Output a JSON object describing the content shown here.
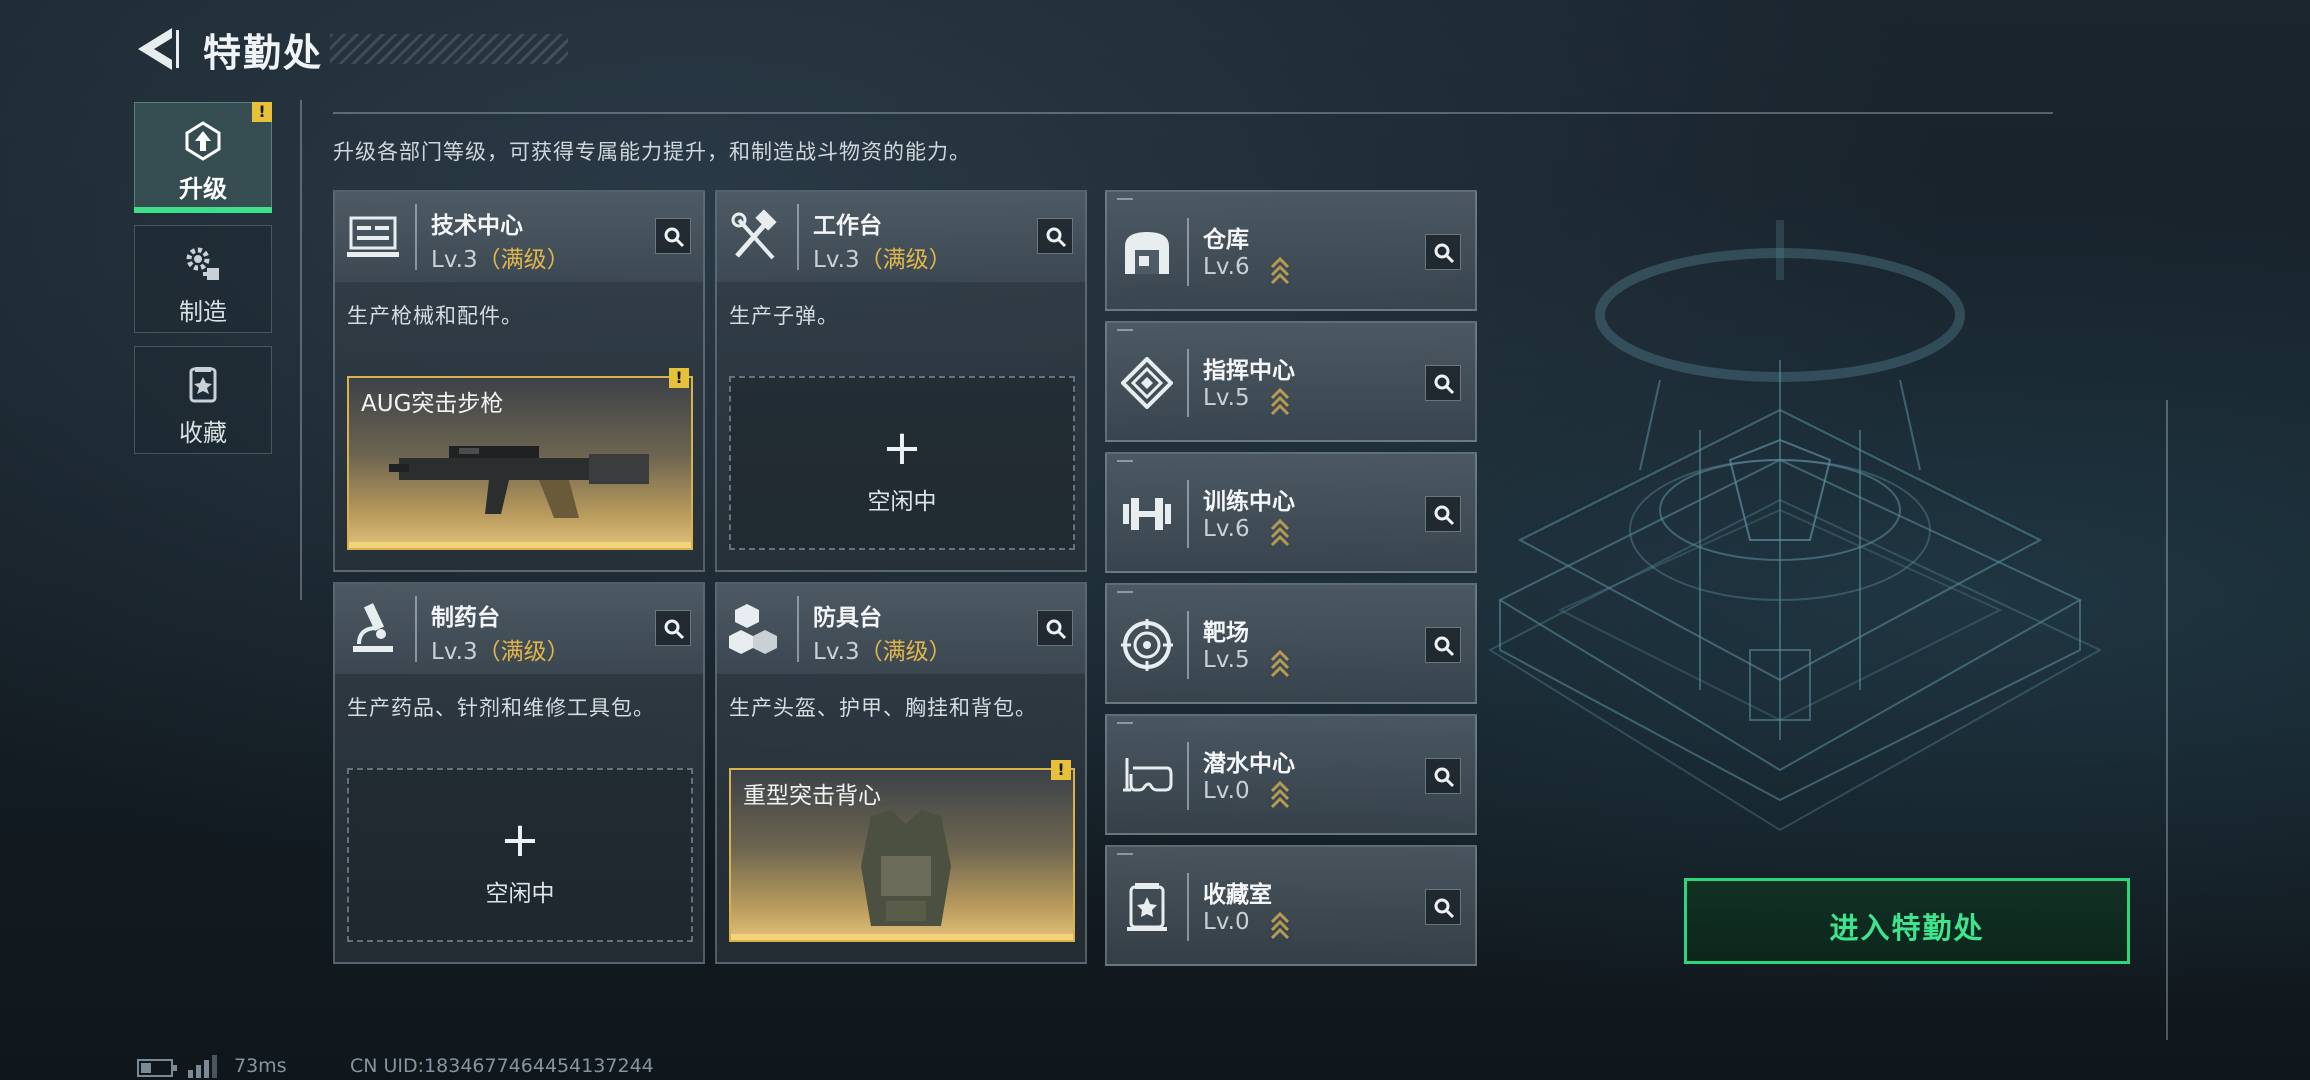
{
  "header": {
    "title": "特勤处"
  },
  "side_tabs": [
    {
      "label": "升级",
      "icon": "upgrade-icon",
      "active": true
    },
    {
      "label": "制造",
      "icon": "gears-icon",
      "active": false
    },
    {
      "label": "收藏",
      "icon": "collection-icon",
      "active": false
    }
  ],
  "subtitle": "升级各部门等级，可获得专属能力提升，和制造战斗物资的能力。",
  "cards": [
    {
      "name": "技术中心",
      "level": "Lv.3",
      "max_tag": "（满级）",
      "desc": "生产枪械和配件。",
      "icon": "tech-center-icon",
      "slot": {
        "type": "item",
        "name": "AUG突击步枪"
      }
    },
    {
      "name": "工作台",
      "level": "Lv.3",
      "max_tag": "（满级）",
      "desc": "生产子弹。",
      "icon": "workbench-icon",
      "slot": {
        "type": "empty",
        "label": "空闲中"
      }
    },
    {
      "name": "制药台",
      "level": "Lv.3",
      "max_tag": "（满级）",
      "desc": "生产药品、针剂和维修工具包。",
      "icon": "pharmacy-icon",
      "slot": {
        "type": "empty",
        "label": "空闲中"
      }
    },
    {
      "name": "防具台",
      "level": "Lv.3",
      "max_tag": "（满级）",
      "desc": "生产头盔、护甲、胸挂和背包。",
      "icon": "armor-bench-icon",
      "slot": {
        "type": "item",
        "name": "重型突击背心"
      }
    }
  ],
  "rows": [
    {
      "name": "仓库",
      "level": "Lv.6",
      "icon": "warehouse-icon"
    },
    {
      "name": "指挥中心",
      "level": "Lv.5",
      "icon": "command-center-icon"
    },
    {
      "name": "训练中心",
      "level": "Lv.6",
      "icon": "dumbbell-icon"
    },
    {
      "name": "靶场",
      "level": "Lv.5",
      "icon": "target-icon"
    },
    {
      "name": "潜水中心",
      "level": "Lv.0",
      "icon": "dive-mask-icon"
    },
    {
      "name": "收藏室",
      "level": "Lv.0",
      "icon": "trophy-room-icon"
    }
  ],
  "enter_button": {
    "label": "进入特勤处"
  },
  "status": {
    "ping": "73ms",
    "uid": "CN UID:1834677464454137244"
  },
  "colors": {
    "accent_green": "#2ed67a",
    "gold": "#e2b64a",
    "warning": "#e8c13a"
  }
}
